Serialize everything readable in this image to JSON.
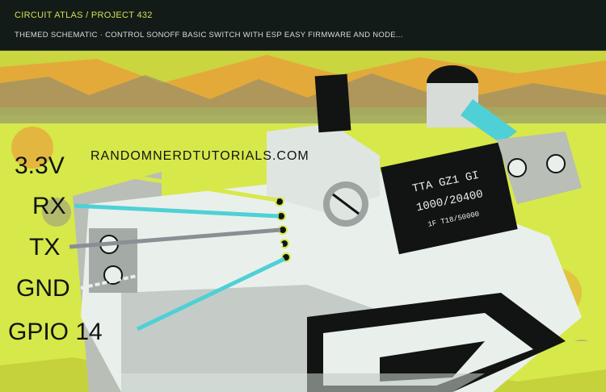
{
  "header": {
    "breadcrumb": "CIRCUIT ATLAS / PROJECT 432",
    "subtitle": "THEMED SCHEMATIC · CONTROL SONOFF BASIC SWITCH WITH ESP EASY FIRMWARE AND NODE..."
  },
  "photo": {
    "watermark": "RANDOMNERDTUTORIALS.COM",
    "relay_text_line1": "TTA GZ1 GI",
    "relay_text_line2": "1000/20400",
    "relay_text_line3": "1F T18/50000"
  },
  "pins": [
    {
      "label": "3.3V",
      "color": "#d7e84a"
    },
    {
      "label": "RX",
      "color": "#4fd0d6"
    },
    {
      "label": "TX",
      "color": "#8a8f93"
    },
    {
      "label": "GND",
      "color": "#e8ede8"
    },
    {
      "label": "GPIO 14",
      "color": "#4fd0d6"
    }
  ],
  "colors": {
    "bg_yellow": "#d7e84a",
    "bg_orange": "#e8a23a",
    "board": "#e9f0ec",
    "cyan": "#4fd0d6",
    "dark": "#111412"
  }
}
